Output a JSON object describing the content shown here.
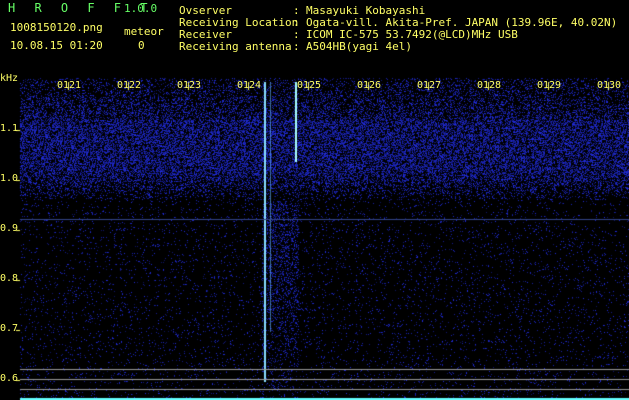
{
  "header": {
    "app_name": "H R O F F T",
    "version": "1.0.0",
    "filename": "1008150120.png",
    "datetime": "10.08.15 01:20",
    "meteor_label": "meteor",
    "meteor_count": "0"
  },
  "station": {
    "labels": [
      "Ovserver",
      "Receiving Location",
      "Receiver",
      "Receiving antenna"
    ],
    "values": [
      "Masayuki Kobayashi",
      "Ogata-vill. Akita-Pref. JAPAN (139.96E, 40.02N)",
      "ICOM IC-575 53.7492(@LCD)MHz USB",
      "A504HB(yagi 4el)"
    ]
  },
  "spectrogram": {
    "unit_label": "kHz",
    "freq_ticks": [
      "1.1",
      "1.0",
      "0.9",
      "0.8",
      "0.7",
      "0.6"
    ],
    "time_ticks": [
      "0121",
      "0122",
      "0123",
      "0124",
      "0125",
      "0126",
      "0127",
      "0128",
      "0129",
      "0130"
    ],
    "colors": {
      "text": "#ffff66",
      "brand": "#66ff66",
      "signal": "#2233cc",
      "bright": "#aaffff",
      "background": "#000000"
    }
  }
}
